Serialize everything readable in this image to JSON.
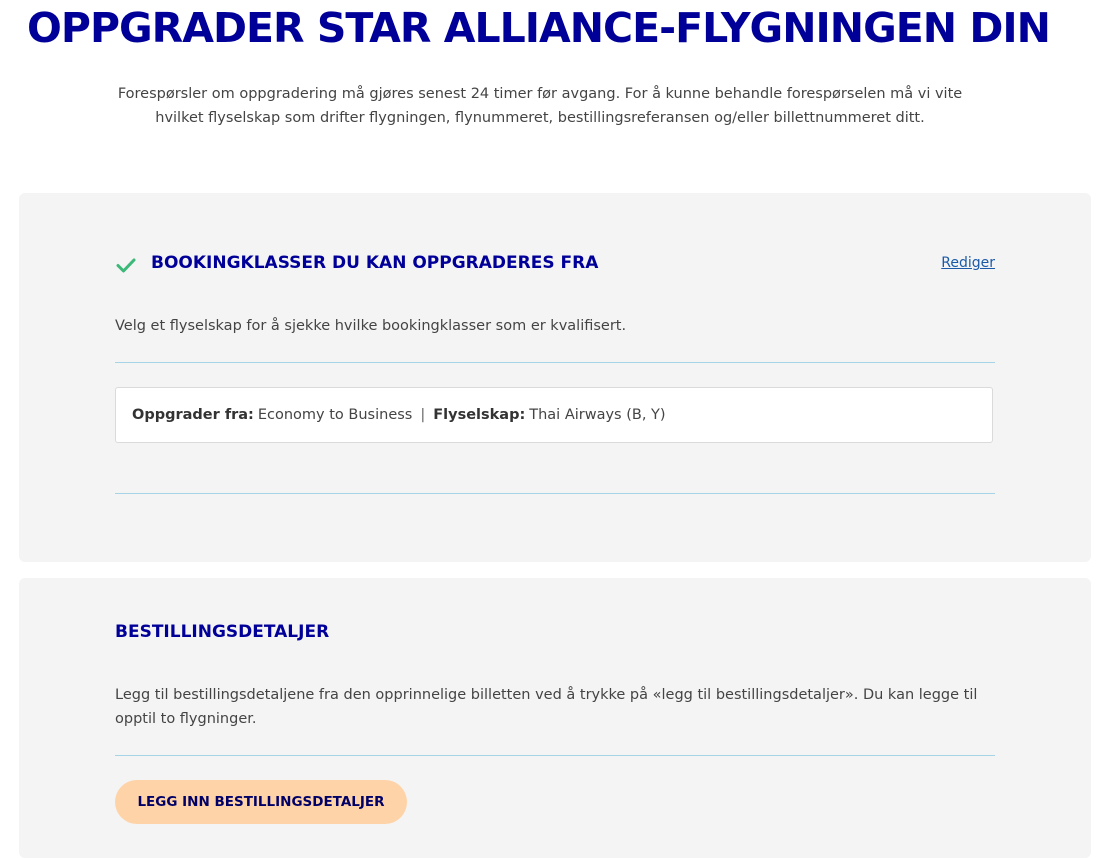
{
  "page": {
    "title": "OPPGRADER STAR ALLIANCE-FLYGNINGEN DIN",
    "intro": "Forespørsler om oppgradering må gjøres senest 24 timer før avgang. For å kunne behandle forespørselen må vi vite hvilket flyselskap som drifter flygningen, flynummeret, bestillingsreferansen og/eller billettnummeret ditt."
  },
  "booking_classes": {
    "title": "BOOKINGKLASSER DU KAN OPPGRADERES FRA",
    "edit_label": "Rediger",
    "description": "Velg et flyselskap for å sjekke hvilke bookingklasser som er kvalifisert.",
    "status_icon": "check-icon",
    "summary": {
      "upgrade_label": "Oppgrader fra:",
      "upgrade_value": "Economy to Business",
      "separator": "|",
      "airline_label": "Flyselskap:",
      "airline_value": "Thai Airways (B, Y)"
    }
  },
  "order_details": {
    "title": "BESTILLINGSDETALJER",
    "description": "Legg til bestillingsdetaljene fra den opprinnelige billetten ved å trykke på «legg til bestillingsdetaljer». Du kan legge til opptil to flygninger.",
    "button_label": "LEGG INN BESTILLINGSDETALJER"
  },
  "colors": {
    "heading": "#000099",
    "check": "#3cb878",
    "link": "#1a5aa8",
    "divider": "#a7d3e6",
    "card_bg": "#f4f4f4",
    "button_bg": "#fed3a8"
  }
}
